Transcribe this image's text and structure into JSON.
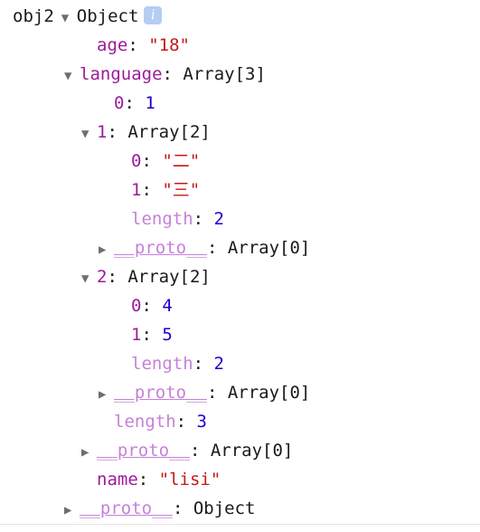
{
  "root": {
    "variable_name": "obj2",
    "type_label": "Object",
    "info_icon": "info-icon",
    "info_glyph": "i"
  },
  "colors": {
    "key": "#9b1b9b",
    "key_dim": "#c582d8",
    "string": "#c41a16",
    "number": "#1c00cf",
    "plain": "#1a1a1a",
    "triangle": "#6e6e6e",
    "info_badge_bg": "#b4cdf2",
    "background": "#ffffff",
    "rule": "#e4e4e4"
  },
  "rows": [
    {
      "id": "root",
      "indent": 0,
      "toggle": "open",
      "prefix": "obj2",
      "key": "",
      "key_style": "",
      "separator": "",
      "value": "Object",
      "value_style": "plain",
      "badge": "i"
    },
    {
      "id": "age",
      "indent": 4,
      "toggle": "none",
      "prefix": "",
      "key": "age",
      "key_style": "key",
      "separator": ":",
      "value": "\"18\"",
      "value_style": "str",
      "badge": ""
    },
    {
      "id": "language",
      "indent": 3,
      "toggle": "open",
      "prefix": "",
      "key": "language",
      "key_style": "key",
      "separator": ":",
      "value": "Array[3]",
      "value_style": "plain",
      "badge": ""
    },
    {
      "id": "language-0",
      "indent": 5,
      "toggle": "none",
      "prefix": "",
      "key": "0",
      "key_style": "key",
      "separator": ":",
      "value": "1",
      "value_style": "num",
      "badge": ""
    },
    {
      "id": "language-1",
      "indent": 4,
      "toggle": "open",
      "prefix": "",
      "key": "1",
      "key_style": "key",
      "separator": ":",
      "value": "Array[2]",
      "value_style": "plain",
      "badge": ""
    },
    {
      "id": "language-1-0",
      "indent": 6,
      "toggle": "none",
      "prefix": "",
      "key": "0",
      "key_style": "key",
      "separator": ":",
      "value": "\"二\"",
      "value_style": "str",
      "badge": ""
    },
    {
      "id": "language-1-1",
      "indent": 6,
      "toggle": "none",
      "prefix": "",
      "key": "1",
      "key_style": "key",
      "separator": ":",
      "value": "\"三\"",
      "value_style": "str",
      "badge": ""
    },
    {
      "id": "language-1-length",
      "indent": 6,
      "toggle": "none",
      "prefix": "",
      "key": "length",
      "key_style": "dim",
      "separator": ":",
      "value": "2",
      "value_style": "num",
      "badge": ""
    },
    {
      "id": "language-1-proto",
      "indent": 5,
      "toggle": "closed",
      "prefix": "",
      "key": "__proto__",
      "key_style": "proto",
      "separator": ":",
      "value": "Array[0]",
      "value_style": "plain",
      "badge": ""
    },
    {
      "id": "language-2",
      "indent": 4,
      "toggle": "open",
      "prefix": "",
      "key": "2",
      "key_style": "key",
      "separator": ":",
      "value": "Array[2]",
      "value_style": "plain",
      "badge": ""
    },
    {
      "id": "language-2-0",
      "indent": 6,
      "toggle": "none",
      "prefix": "",
      "key": "0",
      "key_style": "key",
      "separator": ":",
      "value": "4",
      "value_style": "num",
      "badge": ""
    },
    {
      "id": "language-2-1",
      "indent": 6,
      "toggle": "none",
      "prefix": "",
      "key": "1",
      "key_style": "key",
      "separator": ":",
      "value": "5",
      "value_style": "num",
      "badge": ""
    },
    {
      "id": "language-2-length",
      "indent": 6,
      "toggle": "none",
      "prefix": "",
      "key": "length",
      "key_style": "dim",
      "separator": ":",
      "value": "2",
      "value_style": "num",
      "badge": ""
    },
    {
      "id": "language-2-proto",
      "indent": 5,
      "toggle": "closed",
      "prefix": "",
      "key": "__proto__",
      "key_style": "proto",
      "separator": ":",
      "value": "Array[0]",
      "value_style": "plain",
      "badge": ""
    },
    {
      "id": "language-length",
      "indent": 5,
      "toggle": "none",
      "prefix": "",
      "key": "length",
      "key_style": "dim",
      "separator": ":",
      "value": "3",
      "value_style": "num",
      "badge": ""
    },
    {
      "id": "language-proto",
      "indent": 4,
      "toggle": "closed",
      "prefix": "",
      "key": "__proto__",
      "key_style": "proto",
      "separator": ":",
      "value": "Array[0]",
      "value_style": "plain",
      "badge": ""
    },
    {
      "id": "name",
      "indent": 4,
      "toggle": "none",
      "prefix": "",
      "key": "name",
      "key_style": "key",
      "separator": ":",
      "value": "\"lisi\"",
      "value_style": "str",
      "badge": ""
    },
    {
      "id": "root-proto",
      "indent": 3,
      "toggle": "closed",
      "prefix": "",
      "key": "__proto__",
      "key_style": "proto",
      "separator": ":",
      "value": "Object",
      "value_style": "plain",
      "badge": ""
    }
  ]
}
